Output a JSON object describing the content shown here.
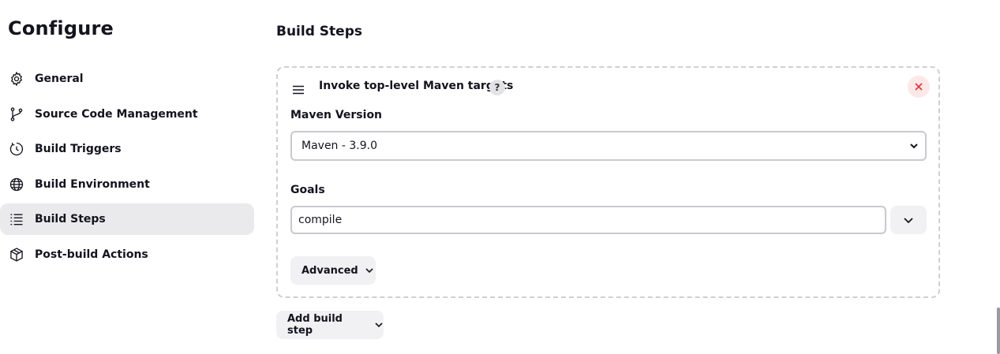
{
  "page": {
    "title": "Configure"
  },
  "sidebar": {
    "items": [
      {
        "label": "General",
        "icon": "gear-icon",
        "active": false
      },
      {
        "label": "Source Code Management",
        "icon": "branch-icon",
        "active": false
      },
      {
        "label": "Build Triggers",
        "icon": "clock-icon",
        "active": false
      },
      {
        "label": "Build Environment",
        "icon": "globe-icon",
        "active": false
      },
      {
        "label": "Build Steps",
        "icon": "list-icon",
        "active": true
      },
      {
        "label": "Post-build Actions",
        "icon": "package-icon",
        "active": false
      }
    ]
  },
  "main": {
    "section_title": "Build Steps",
    "step": {
      "title": "Invoke top-level Maven targets",
      "help": "?",
      "close_icon": "close-icon",
      "maven_version": {
        "label": "Maven Version",
        "value": "Maven - 3.9.0"
      },
      "goals": {
        "label": "Goals",
        "value": "compile"
      },
      "advanced_label": "Advanced"
    },
    "add_step_label": "Add build step"
  },
  "colors": {
    "active_bg": "#eaeaed",
    "close_red": "#e0353a",
    "button_bg": "#f1f1f3",
    "border": "#cfcfd4"
  }
}
